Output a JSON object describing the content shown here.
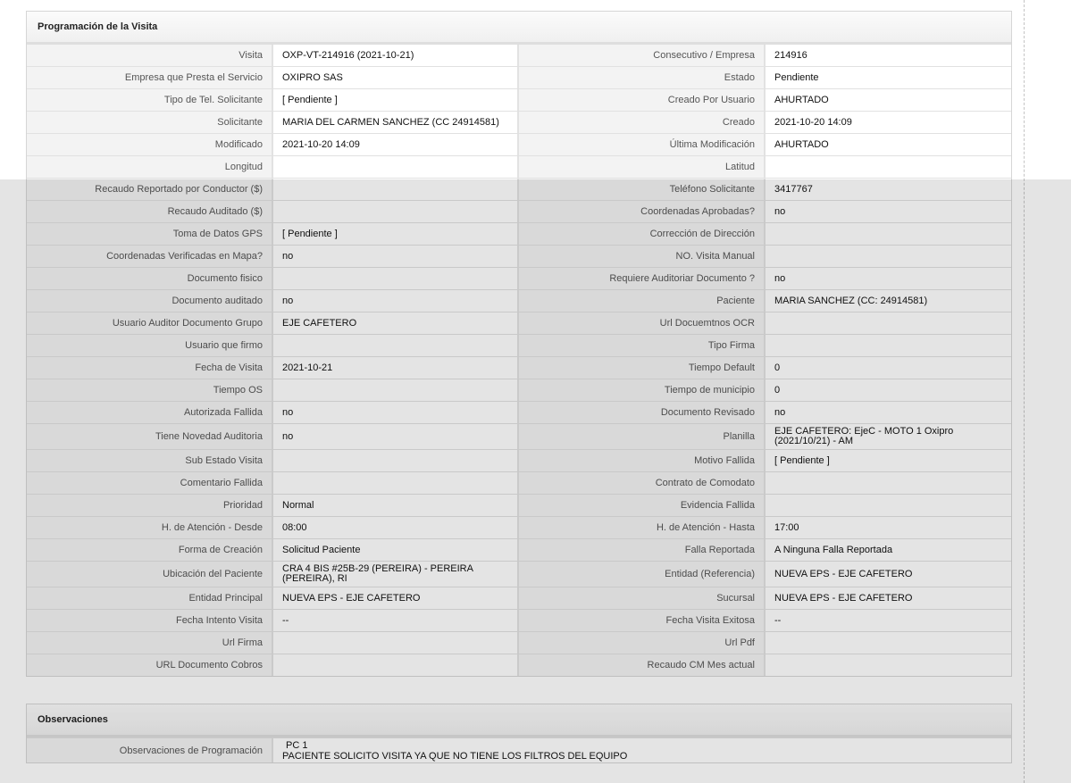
{
  "programacion": {
    "title": "Programación de la Visita",
    "rows": [
      {
        "l1": "Visita",
        "v1": "OXP-VT-214916 (2021-10-21)",
        "l2": "Consecutivo / Empresa",
        "v2": "214916"
      },
      {
        "l1": "Empresa que Presta el Servicio",
        "v1": "OXIPRO SAS",
        "l2": "Estado",
        "v2": "Pendiente"
      },
      {
        "l1": "Tipo de Tel. Solicitante",
        "v1": "[ Pendiente ]",
        "l2": "Creado Por Usuario",
        "v2": "AHURTADO"
      },
      {
        "l1": "Solicitante",
        "v1": "MARIA DEL CARMEN SANCHEZ (CC 24914581)",
        "l2": "Creado",
        "v2": "2021-10-20 14:09"
      },
      {
        "l1": "Modificado",
        "v1": "2021-10-20 14:09",
        "l2": "Última Modificación",
        "v2": "AHURTADO"
      },
      {
        "l1": "Longitud",
        "v1": "",
        "l2": "Latitud",
        "v2": ""
      },
      {
        "l1": "Recaudo Reportado por Conductor ($)",
        "v1": "",
        "l2": "Teléfono Solicitante",
        "v2": "3417767"
      },
      {
        "l1": "Recaudo Auditado ($)",
        "v1": "",
        "l2": "Coordenadas Aprobadas?",
        "v2": "no"
      },
      {
        "l1": "Toma de Datos GPS",
        "v1": "[ Pendiente ]",
        "l2": "Corrección de Dirección",
        "v2": ""
      },
      {
        "l1": "Coordenadas Verificadas en Mapa?",
        "v1": "no",
        "l2": "NO. Visita Manual",
        "v2": ""
      },
      {
        "l1": "Documento fisico",
        "v1": "",
        "l2": "Requiere Auditoriar Documento ?",
        "v2": "no"
      },
      {
        "l1": "Documento auditado",
        "v1": "no",
        "l2": "Paciente",
        "v2": "MARIA SANCHEZ (CC: 24914581)"
      },
      {
        "l1": "Usuario Auditor Documento Grupo",
        "v1": "EJE CAFETERO",
        "l2": "Url Docuemtnos OCR",
        "v2": ""
      },
      {
        "l1": "Usuario que firmo",
        "v1": "",
        "l2": "Tipo Firma",
        "v2": ""
      },
      {
        "l1": "Fecha de Visita",
        "v1": "2021-10-21",
        "l2": "Tiempo Default",
        "v2": "0"
      },
      {
        "l1": "Tiempo OS",
        "v1": "",
        "l2": "Tiempo de municipio",
        "v2": "0"
      },
      {
        "l1": "Autorizada Fallida",
        "v1": "no",
        "l2": "Documento Revisado",
        "v2": "no"
      },
      {
        "l1": "Tiene Novedad Auditoria",
        "v1": "no",
        "l2": "Planilla",
        "v2": "EJE CAFETERO: EjeC - MOTO 1 Oxipro (2021/10/21) - AM"
      },
      {
        "l1": "Sub Estado Visita",
        "v1": "",
        "l2": "Motivo Fallida",
        "v2": "[ Pendiente ]"
      },
      {
        "l1": "Comentario Fallida",
        "v1": "",
        "l2": "Contrato de Comodato",
        "v2": ""
      },
      {
        "l1": "Prioridad",
        "v1": "Normal",
        "l2": "Evidencia Fallida",
        "v2": ""
      },
      {
        "l1": "H. de Atención - Desde",
        "v1": "08:00",
        "l2": "H. de Atención - Hasta",
        "v2": "17:00"
      },
      {
        "l1": "Forma de Creación",
        "v1": "Solicitud Paciente",
        "l2": "Falla Reportada",
        "v2": "A Ninguna Falla Reportada"
      },
      {
        "l1": "Ubicación del Paciente",
        "v1": "CRA 4 BIS #25B-29 (PEREIRA) - PEREIRA (PEREIRA), RI",
        "l2": "Entidad (Referencia)",
        "v2": "NUEVA EPS - EJE CAFETERO"
      },
      {
        "l1": "Entidad Principal",
        "v1": "NUEVA EPS - EJE CAFETERO",
        "l2": "Sucursal",
        "v2": "NUEVA EPS - EJE CAFETERO"
      },
      {
        "l1": "Fecha Intento Visita",
        "v1": "--",
        "l2": "Fecha Visita Exitosa",
        "v2": "--"
      },
      {
        "l1": "Url Firma",
        "v1": "",
        "l2": "Url Pdf",
        "v2": ""
      },
      {
        "l1": "URL Documento Cobros",
        "v1": "",
        "l2": "Recaudo CM Mes actual",
        "v2": ""
      }
    ]
  },
  "observaciones": {
    "title": "Observaciones",
    "label": "Observaciones de Programación",
    "line1": "PC 1",
    "line2": "PACIENTE SOLICITO VISITA YA QUE NO TIENE LOS FILTROS DEL EQUIPO"
  }
}
